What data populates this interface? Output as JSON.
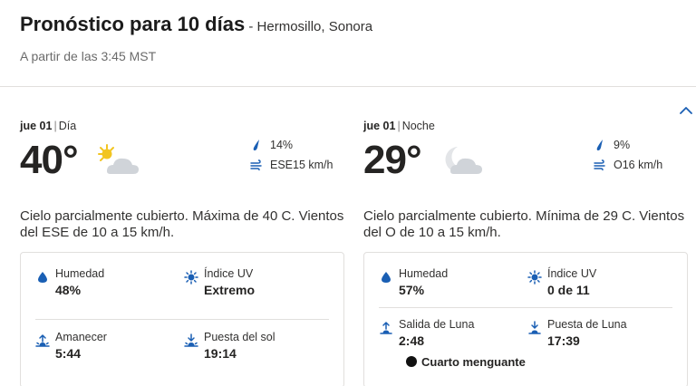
{
  "header": {
    "title": "Pronóstico para 10 días",
    "location": " - Hermosillo, Sonora",
    "as_of": "A partir de las 3:45 MST"
  },
  "day": {
    "date": "jue 01",
    "period": "Día",
    "temperature": "40°",
    "icon": "partly-cloudy-day-icon",
    "precip": "14%",
    "wind": "ESE15 km/h",
    "description": "Cielo parcialmente cubierto. Máxima de 40 C. Vientos del ESE de 10 a 15 km/h.",
    "details": {
      "humidity_label": "Humedad",
      "humidity_value": "48%",
      "uv_label": "Índice UV",
      "uv_value": "Extremo",
      "sunrise_label": "Amanecer",
      "sunrise_value": "5:44",
      "sunset_label": "Puesta del sol",
      "sunset_value": "19:14"
    }
  },
  "night": {
    "date": "jue 01",
    "period": "Noche",
    "temperature": "29°",
    "icon": "partly-cloudy-night-icon",
    "precip": "9%",
    "wind": "O16 km/h",
    "description": "Cielo parcialmente cubierto. Mínima de 29 C. Vientos del O de 10 a 15 km/h.",
    "details": {
      "humidity_label": "Humedad",
      "humidity_value": "57%",
      "uv_label": "Índice UV",
      "uv_value": "0 de 11",
      "moonrise_label": "Salida de Luna",
      "moonrise_value": "2:48",
      "moonset_label": "Puesta de Luna",
      "moonset_value": "17:39",
      "moon_phase": "Cuarto menguante"
    }
  },
  "colors": {
    "accent": "#1a5fb4",
    "divider": "#e1dfdd",
    "sun": "#f2c521",
    "cloud": "#d0d4d9"
  }
}
